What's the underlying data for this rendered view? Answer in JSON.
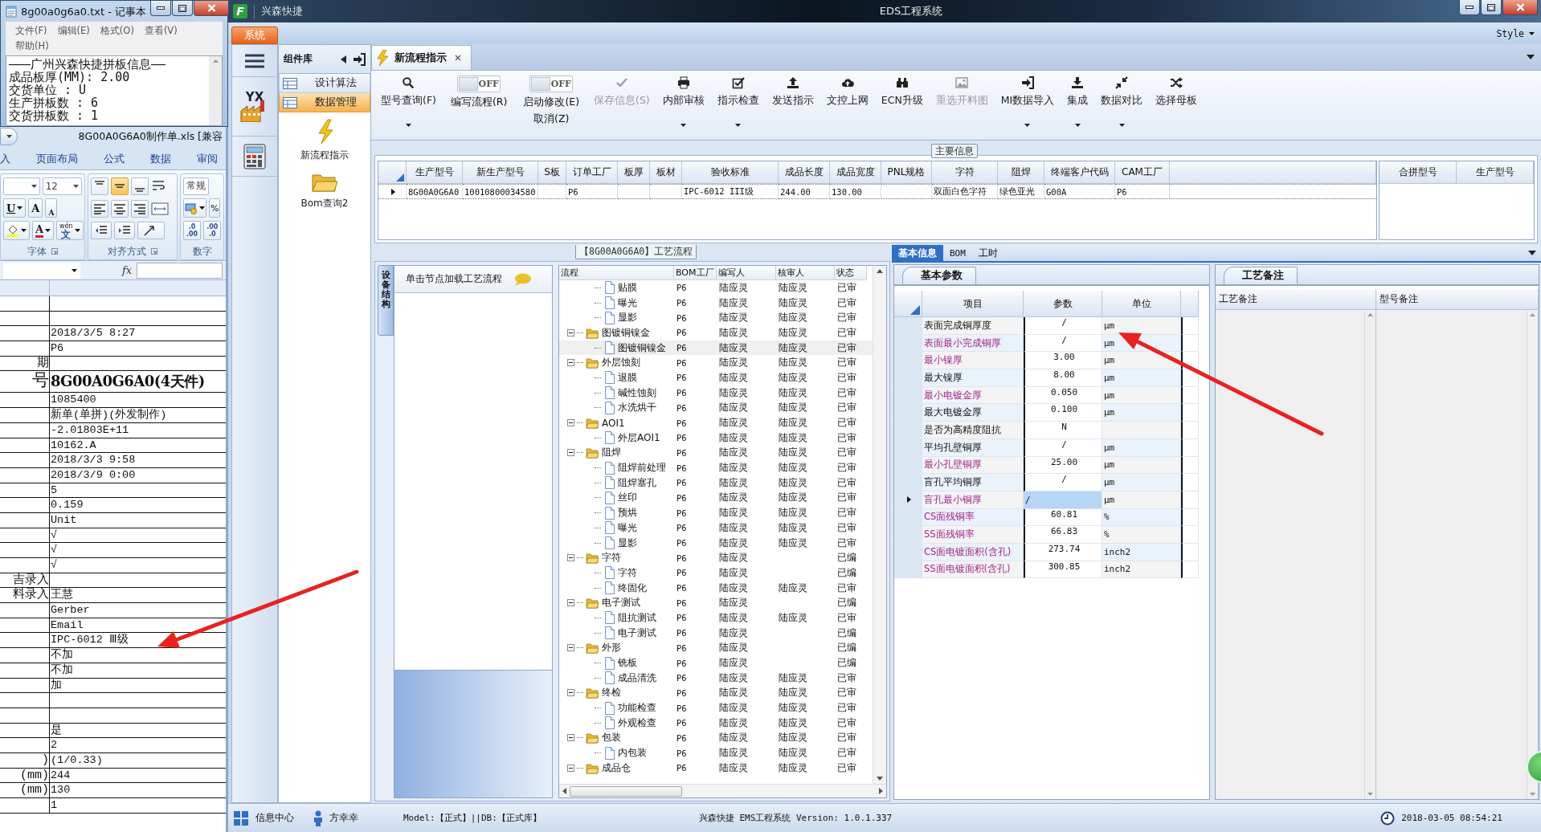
{
  "notepad": {
    "title": "8g00a0g6a0.txt - 记事本",
    "menu": [
      "文件(F)",
      "编辑(E)",
      "格式(O)",
      "查看(V)",
      "帮助(H)"
    ],
    "lines": [
      "———广州兴森快捷拼板信息——",
      "成品板厚(MM): 2.00",
      "交货单位 : U",
      "生产拼板数 : 6",
      "交货拼板数 : 1"
    ]
  },
  "excel": {
    "title": "8G00A0G6A0制作单.xls [兼容",
    "tabs": [
      "入",
      "页面布局",
      "公式",
      "数据",
      "审阅"
    ],
    "ribbon": {
      "font_size": "12",
      "underline": "U",
      "grow": "A",
      "shrink": "A",
      "font_color": "A",
      "phonetic_ruby": "wén",
      "phonetic": "文",
      "number_format": "常规",
      "percent": "%",
      "decimals": [
        [
          ".0",
          ".00"
        ],
        [
          ".00",
          ".0"
        ]
      ],
      "groups": [
        "字体",
        "对齐方式",
        "数字"
      ],
      "align_buttons": [
        {
          "selected": false
        },
        {
          "selected": true
        },
        {
          "selected": false
        }
      ]
    },
    "fx": "fx",
    "rows": [
      {
        "kind": "blank"
      },
      {
        "kind": "blank"
      },
      {
        "kind": "text",
        "value": "2018/3/5 8:27"
      },
      {
        "kind": "text",
        "value": "P6"
      },
      {
        "kind": "text",
        "label": "期"
      },
      {
        "kind": "title",
        "label": "号",
        "value": "8G00A0G6A0(4天件)"
      },
      {
        "kind": "text",
        "value": "1085400"
      },
      {
        "kind": "text",
        "value": "新单(单拼)(外发制作)"
      },
      {
        "kind": "text",
        "value": "-2.01803E+11"
      },
      {
        "kind": "text",
        "value": "10162.A"
      },
      {
        "kind": "text",
        "value": "2018/3/3 9:58"
      },
      {
        "kind": "text",
        "value": "2018/3/9 0:00"
      },
      {
        "kind": "text",
        "value": "5"
      },
      {
        "kind": "text",
        "value": "0.159"
      },
      {
        "kind": "text",
        "value": "Unit"
      },
      {
        "kind": "text",
        "value": "√"
      },
      {
        "kind": "text",
        "value": "√"
      },
      {
        "kind": "text",
        "value": "√"
      },
      {
        "kind": "text",
        "label": "吉录入"
      },
      {
        "kind": "text",
        "label": "料录入",
        "value": "王慧"
      },
      {
        "kind": "text",
        "value": "Gerber"
      },
      {
        "kind": "text",
        "value": "Email"
      },
      {
        "kind": "text",
        "value": "IPC-6012 Ⅲ级"
      },
      {
        "kind": "text",
        "value": "不加"
      },
      {
        "kind": "text",
        "value": "不加"
      },
      {
        "kind": "text",
        "value": "加"
      },
      {
        "kind": "blank"
      },
      {
        "kind": "blank"
      },
      {
        "kind": "text",
        "value": "是"
      },
      {
        "kind": "text",
        "value": "2"
      },
      {
        "kind": "text",
        "label": ")",
        "value": "(1/0.33)"
      },
      {
        "kind": "text",
        "label": "(mm)",
        "value": "244"
      },
      {
        "kind": "text",
        "label": "(mm)",
        "value": "130"
      },
      {
        "kind": "text",
        "value": "1"
      }
    ]
  },
  "app": {
    "logo_text": "F",
    "title": "兴森快捷",
    "center_title": "EDS工程系统",
    "menu_tab": "系统",
    "style_menu": "Style",
    "left_rail": {
      "logo_text": "YX"
    },
    "component_panel": {
      "title": "组件库",
      "items": [
        {
          "label": "设计算法",
          "selected": false
        },
        {
          "label": "数据管理",
          "selected": true
        }
      ],
      "launchers": [
        {
          "label": "新流程指示"
        },
        {
          "label": "Bom查询2"
        }
      ]
    },
    "doc_tab": {
      "label": "新流程指示",
      "selected": true
    },
    "toolbar": [
      {
        "kind": "button",
        "label": "型号查询(F)",
        "dropdown": true,
        "disabled": false
      },
      {
        "kind": "toggle",
        "toggle_text": "OFF",
        "label": "编写流程(R)",
        "on": false
      },
      {
        "kind": "toggle",
        "toggle_text": "OFF",
        "label": "启动修改(E)",
        "label2": "取消(Z)",
        "on": false
      },
      {
        "kind": "button",
        "label": "保存信息(S)",
        "dropdown": false,
        "disabled": true
      },
      {
        "kind": "button",
        "label": "内部审核",
        "dropdown": true,
        "disabled": false
      },
      {
        "kind": "button",
        "label": "指示检查",
        "dropdown": true,
        "disabled": false
      },
      {
        "kind": "button",
        "label": "发送指示",
        "dropdown": false,
        "disabled": false
      },
      {
        "kind": "button",
        "label": "文控上网",
        "dropdown": false,
        "disabled": false
      },
      {
        "kind": "button",
        "label": "ECN升级",
        "dropdown": false,
        "disabled": false
      },
      {
        "kind": "button",
        "label": "重选开料图",
        "dropdown": false,
        "disabled": true
      },
      {
        "kind": "button",
        "label": "MI数据导入",
        "dropdown": true,
        "disabled": false
      },
      {
        "kind": "button",
        "label": "集成",
        "dropdown": true,
        "disabled": false
      },
      {
        "kind": "button",
        "label": "数据对比",
        "dropdown": true,
        "disabled": false
      },
      {
        "kind": "button",
        "label": "选择母板",
        "dropdown": false,
        "disabled": false
      }
    ],
    "main_info": {
      "legend": "主要信息",
      "columns": [
        {
          "header": "生产型号",
          "value": "8G00A0G6A0"
        },
        {
          "header": "新生产型号",
          "value": "10010800034580"
        },
        {
          "header": "S板"
        },
        {
          "header": "订单工厂",
          "value": "P6"
        },
        {
          "header": "板厚"
        },
        {
          "header": "板材"
        },
        {
          "header": "验收标准",
          "value": "IPC-6012 III级"
        },
        {
          "header": "成品长度",
          "value": "244.00"
        },
        {
          "header": "成品宽度",
          "value": "130.00"
        },
        {
          "header": "PNL规格"
        },
        {
          "header": "字符",
          "value": "双面白色字符"
        },
        {
          "header": "阻焊",
          "value": "绿色亚光"
        },
        {
          "header": "终端客户代码",
          "value": "G00A"
        },
        {
          "header": "CAM工厂",
          "value": "P6"
        }
      ],
      "side_columns": [
        "合拼型号",
        "生产型号"
      ]
    },
    "process": {
      "legend": "【8G00A0G6A0】工艺流程",
      "side_tab": "设备结构",
      "hint": "单击节点加载工艺流程",
      "columns": [
        "流程",
        "BOM工厂",
        "编写人",
        "核审人",
        "状态"
      ],
      "tree": [
        {
          "children": [
            {
              "label": "贴膜",
              "factory": "P6",
              "writer": "陆应灵",
              "reviewer": "陆应灵",
              "status": "已审",
              "selected": false
            },
            {
              "label": "曝光",
              "factory": "P6",
              "writer": "陆应灵",
              "reviewer": "陆应灵",
              "status": "已审",
              "selected": false
            },
            {
              "label": "显影",
              "factory": "P6",
              "writer": "陆应灵",
              "reviewer": "陆应灵",
              "status": "已审",
              "selected": false
            }
          ]
        },
        {
          "label": "图镀铜镍金",
          "factory": "P6",
          "writer": "陆应灵",
          "reviewer": "陆应灵",
          "status": "已审",
          "selected": false,
          "expanded": true,
          "children": [
            {
              "label": "图镀铜镍金",
              "factory": "P6",
              "writer": "陆应灵",
              "reviewer": "陆应灵",
              "status": "已审",
              "selected": true
            }
          ]
        },
        {
          "label": "外层蚀刻",
          "factory": "P6",
          "writer": "陆应灵",
          "reviewer": "陆应灵",
          "status": "已审",
          "selected": false,
          "expanded": true,
          "children": [
            {
              "label": "退膜",
              "factory": "P6",
              "writer": "陆应灵",
              "reviewer": "陆应灵",
              "status": "已审",
              "selected": false
            },
            {
              "label": "碱性蚀刻",
              "factory": "P6",
              "writer": "陆应灵",
              "reviewer": "陆应灵",
              "status": "已审",
              "selected": false
            },
            {
              "label": "水洗烘干",
              "factory": "P6",
              "writer": "陆应灵",
              "reviewer": "陆应灵",
              "status": "已审",
              "selected": false
            }
          ]
        },
        {
          "label": "AOI1",
          "factory": "P6",
          "writer": "陆应灵",
          "reviewer": "陆应灵",
          "status": "已审",
          "selected": false,
          "expanded": true,
          "children": [
            {
              "label": "外层AOI1",
              "factory": "P6",
              "writer": "陆应灵",
              "reviewer": "陆应灵",
              "status": "已审",
              "selected": false
            }
          ]
        },
        {
          "label": "阻焊",
          "factory": "P6",
          "writer": "陆应灵",
          "reviewer": "陆应灵",
          "status": "已审",
          "selected": false,
          "expanded": true,
          "children": [
            {
              "label": "阻焊前处理",
              "factory": "P6",
              "writer": "陆应灵",
              "reviewer": "陆应灵",
              "status": "已审",
              "selected": false
            },
            {
              "label": "阻焊塞孔",
              "factory": "P6",
              "writer": "陆应灵",
              "reviewer": "陆应灵",
              "status": "已审",
              "selected": false
            },
            {
              "label": "丝印",
              "factory": "P6",
              "writer": "陆应灵",
              "reviewer": "陆应灵",
              "status": "已审",
              "selected": false
            },
            {
              "label": "预烘",
              "factory": "P6",
              "writer": "陆应灵",
              "reviewer": "陆应灵",
              "status": "已审",
              "selected": false
            },
            {
              "label": "曝光",
              "factory": "P6",
              "writer": "陆应灵",
              "reviewer": "陆应灵",
              "status": "已审",
              "selected": false
            },
            {
              "label": "显影",
              "factory": "P6",
              "writer": "陆应灵",
              "reviewer": "陆应灵",
              "status": "已审",
              "selected": false
            }
          ]
        },
        {
          "label": "字符",
          "factory": "P6",
          "writer": "陆应灵",
          "status": "已编",
          "selected": false,
          "expanded": true,
          "children": [
            {
              "label": "字符",
              "factory": "P6",
              "writer": "陆应灵",
              "status": "已编",
              "selected": false
            },
            {
              "label": "终固化",
              "factory": "P6",
              "writer": "陆应灵",
              "reviewer": "陆应灵",
              "status": "已审",
              "selected": false
            }
          ]
        },
        {
          "label": "电子测试",
          "factory": "P6",
          "writer": "陆应灵",
          "status": "已编",
          "selected": false,
          "expanded": true,
          "children": [
            {
              "label": "阻抗测试",
              "factory": "P6",
              "writer": "陆应灵",
              "reviewer": "陆应灵",
              "status": "已审",
              "selected": false
            },
            {
              "label": "电子测试",
              "factory": "P6",
              "writer": "陆应灵",
              "status": "已编",
              "selected": false
            }
          ]
        },
        {
          "label": "外形",
          "factory": "P6",
          "writer": "陆应灵",
          "status": "已编",
          "selected": false,
          "expanded": true,
          "children": [
            {
              "label": "铣板",
              "factory": "P6",
              "writer": "陆应灵",
              "status": "已编",
              "selected": false
            },
            {
              "label": "成品清洗",
              "factory": "P6",
              "writer": "陆应灵",
              "reviewer": "陆应灵",
              "status": "已审",
              "selected": false
            }
          ]
        },
        {
          "label": "终检",
          "factory": "P6",
          "writer": "陆应灵",
          "reviewer": "陆应灵",
          "status": "已审",
          "selected": false,
          "expanded": true,
          "children": [
            {
              "label": "功能检查",
              "factory": "P6",
              "writer": "陆应灵",
              "reviewer": "陆应灵",
              "status": "已审",
              "selected": false
            },
            {
              "label": "外观检查",
              "factory": "P6",
              "writer": "陆应灵",
              "reviewer": "陆应灵",
              "status": "已审",
              "selected": false
            }
          ]
        },
        {
          "label": "包装",
          "factory": "P6",
          "writer": "陆应灵",
          "reviewer": "陆应灵",
          "status": "已审",
          "selected": false,
          "expanded": true,
          "children": [
            {
              "label": "内包装",
              "factory": "P6",
              "writer": "陆应灵",
              "reviewer": "陆应灵",
              "status": "已审",
              "selected": false
            }
          ]
        },
        {
          "label": "成品仓",
          "factory": "P6",
          "writer": "陆应灵",
          "reviewer": "陆应灵",
          "status": "已审",
          "selected": false,
          "expanded": true
        }
      ]
    },
    "detail": {
      "tabs": [
        {
          "label": "基本信息",
          "selected": true
        },
        {
          "label": "BOM",
          "selected": false
        },
        {
          "label": "工时",
          "selected": false
        }
      ],
      "params_tab": "基本参数",
      "param_columns": [
        "项目",
        "参数",
        "单位"
      ],
      "params": [
        {
          "item": "表面完成铜厚度",
          "value": "/",
          "unit": "μm",
          "required": false,
          "selected": false
        },
        {
          "item": "表面最小完成铜厚",
          "value": "/",
          "unit": "μm",
          "required": true,
          "selected": false
        },
        {
          "item": "最小镍厚",
          "value": "3.00",
          "unit": "μm",
          "required": true,
          "selected": false
        },
        {
          "item": "最大镍厚",
          "value": "8.00",
          "unit": "μm",
          "required": false,
          "selected": false
        },
        {
          "item": "最小电镀金厚",
          "value": "0.050",
          "unit": "μm",
          "required": true,
          "selected": false
        },
        {
          "item": "最大电镀金厚",
          "value": "0.100",
          "unit": "μm",
          "required": false,
          "selected": false
        },
        {
          "item": "是否为高精度阻抗",
          "value": "N",
          "required": false,
          "selected": false
        },
        {
          "item": "平均孔壁铜厚",
          "value": "/",
          "unit": "μm",
          "required": false,
          "selected": false
        },
        {
          "item": "最小孔壁铜厚",
          "value": "25.00",
          "unit": "μm",
          "required": true,
          "selected": false
        },
        {
          "item": "盲孔平均铜厚",
          "value": "/",
          "unit": "μm",
          "required": false,
          "selected": false
        },
        {
          "item": "盲孔最小铜厚",
          "value": "/",
          "unit": "μm",
          "required": true,
          "selected": true
        },
        {
          "item": "CS面残铜率",
          "value": "60.81",
          "unit": "%",
          "required": true,
          "selected": false
        },
        {
          "item": "SS面残铜率",
          "value": "66.83",
          "unit": "%",
          "required": true,
          "selected": false
        },
        {
          "item": "CS面电镀面积(含孔)",
          "value": "273.74",
          "unit": "inch2",
          "required": true,
          "selected": false
        },
        {
          "item": "SS面电镀面积(含孔)",
          "value": "300.85",
          "unit": "inch2",
          "required": true,
          "selected": false
        }
      ],
      "notes_tab": "工艺备注",
      "notes_columns": [
        "工艺备注",
        "型号备注"
      ]
    },
    "status_bar": {
      "info_center": "信息中心",
      "user": "方幸幸",
      "model": "Model:【正式】||DB:【正式库】",
      "version": "兴森快捷 EMS工程系统 Version: 1.0.1.337",
      "datetime": "2018-03-05 08:54:21"
    }
  }
}
